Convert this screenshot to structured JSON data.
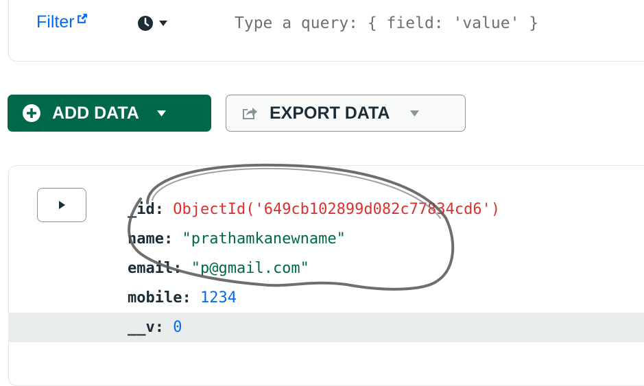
{
  "filter": {
    "label": "Filter",
    "query_placeholder": "Type a query: { field: 'value' }",
    "query_value": ""
  },
  "icons": {
    "external_link": "external-link-icon",
    "history": "clock-icon",
    "dropdown": "caret-down-icon",
    "add": "plus-circle-icon",
    "export": "export-icon",
    "expand": "caret-right-icon"
  },
  "toolbar": {
    "add_data_label": "ADD DATA",
    "export_data_label": "EXPORT DATA"
  },
  "document": {
    "fields": [
      {
        "key": "_id",
        "value": "ObjectId('649cb102899d082c77834cd6')",
        "type": "objectid"
      },
      {
        "key": "name",
        "value": "\"prathamkanewname\"",
        "type": "string"
      },
      {
        "key": "email",
        "value": "\"p@gmail.com\"",
        "type": "string"
      },
      {
        "key": "mobile",
        "value": "1234",
        "type": "number"
      },
      {
        "key": "__v",
        "value": "0",
        "type": "number"
      }
    ],
    "separator": ": "
  },
  "colors": {
    "accent_green": "#00684a",
    "link_blue": "#016bf8",
    "objectid_red": "#db3030",
    "string_green": "#00684a",
    "number_blue": "#016bf8",
    "highlight_row": "#e8edeb"
  }
}
